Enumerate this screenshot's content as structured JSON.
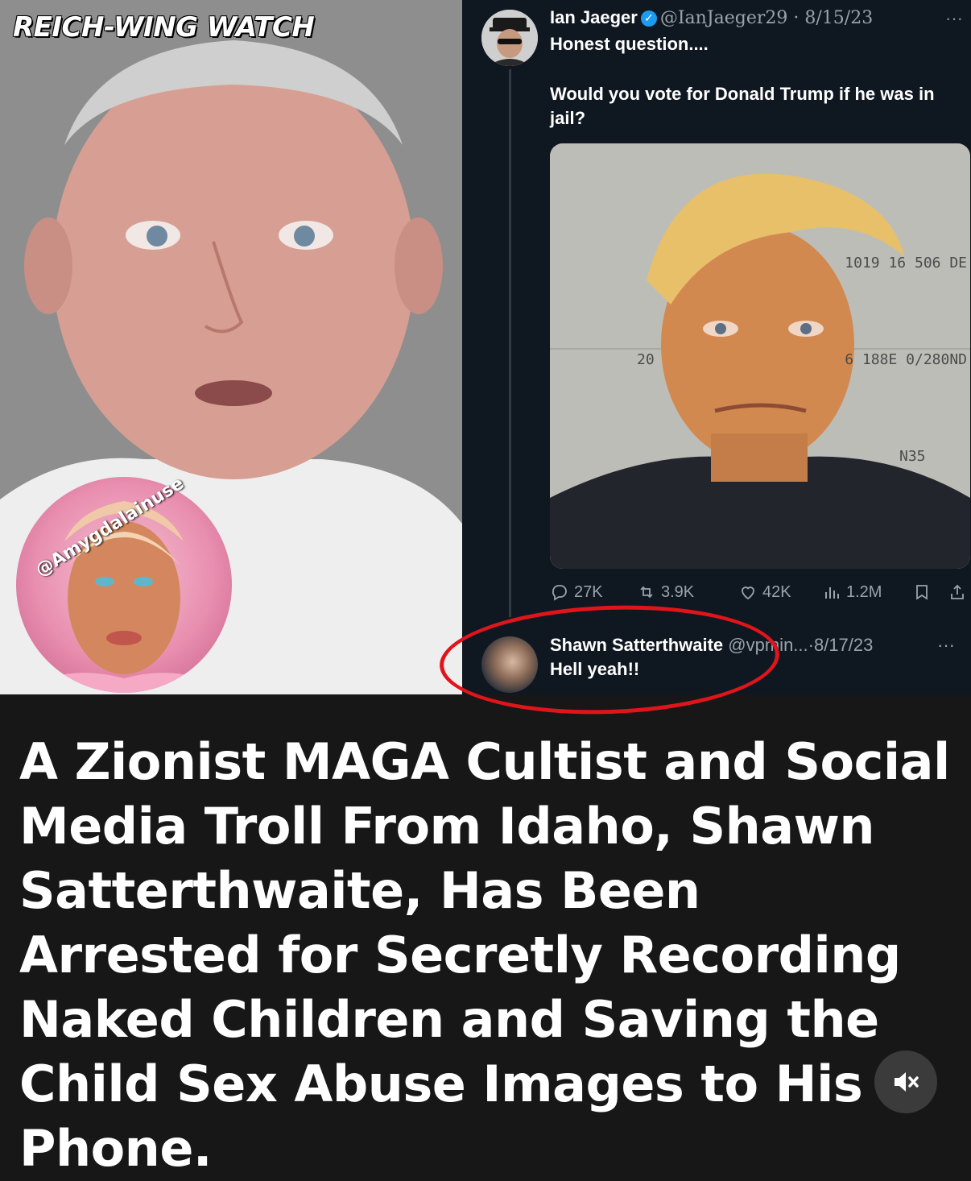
{
  "left_panel": {
    "watermark": "REICH-WING WATCH",
    "avatar_handle": "@Amygdalainuse"
  },
  "tweet": {
    "name": "Ian Jaeger",
    "handle": "@IanJaeger29",
    "date": "8/15/23",
    "separator": "·",
    "more": "···",
    "text_line1": "Honest question....",
    "text_line2": "Would you vote for Donald Trump if he was in jail?",
    "photo_labels": {
      "top_right": "1019 16 506 DE",
      "left": "20",
      "mid_right": "6 188E 0/280ND",
      "bottom": "N35"
    },
    "metrics": {
      "replies": "27K",
      "reposts": "3.9K",
      "likes": "42K",
      "views": "1.2M"
    }
  },
  "reply": {
    "name": "Shawn Satterthwaite",
    "handle": "@vpmin...",
    "date": "8/17/23",
    "text": "Hell yeah!!",
    "more": "···"
  },
  "headline": "A Zionist MAGA Cultist and Social Media Troll From Idaho, Shawn Satterthwaite, Has Been Arrested for Secretly Recording Naked Children and Saving the Child Sex Abuse Images to His Phone.",
  "colors": {
    "background": "#171717",
    "tweet_bg": "#0f1721",
    "verified": "#1d9bf0",
    "highlight_circle": "#e0141b"
  }
}
